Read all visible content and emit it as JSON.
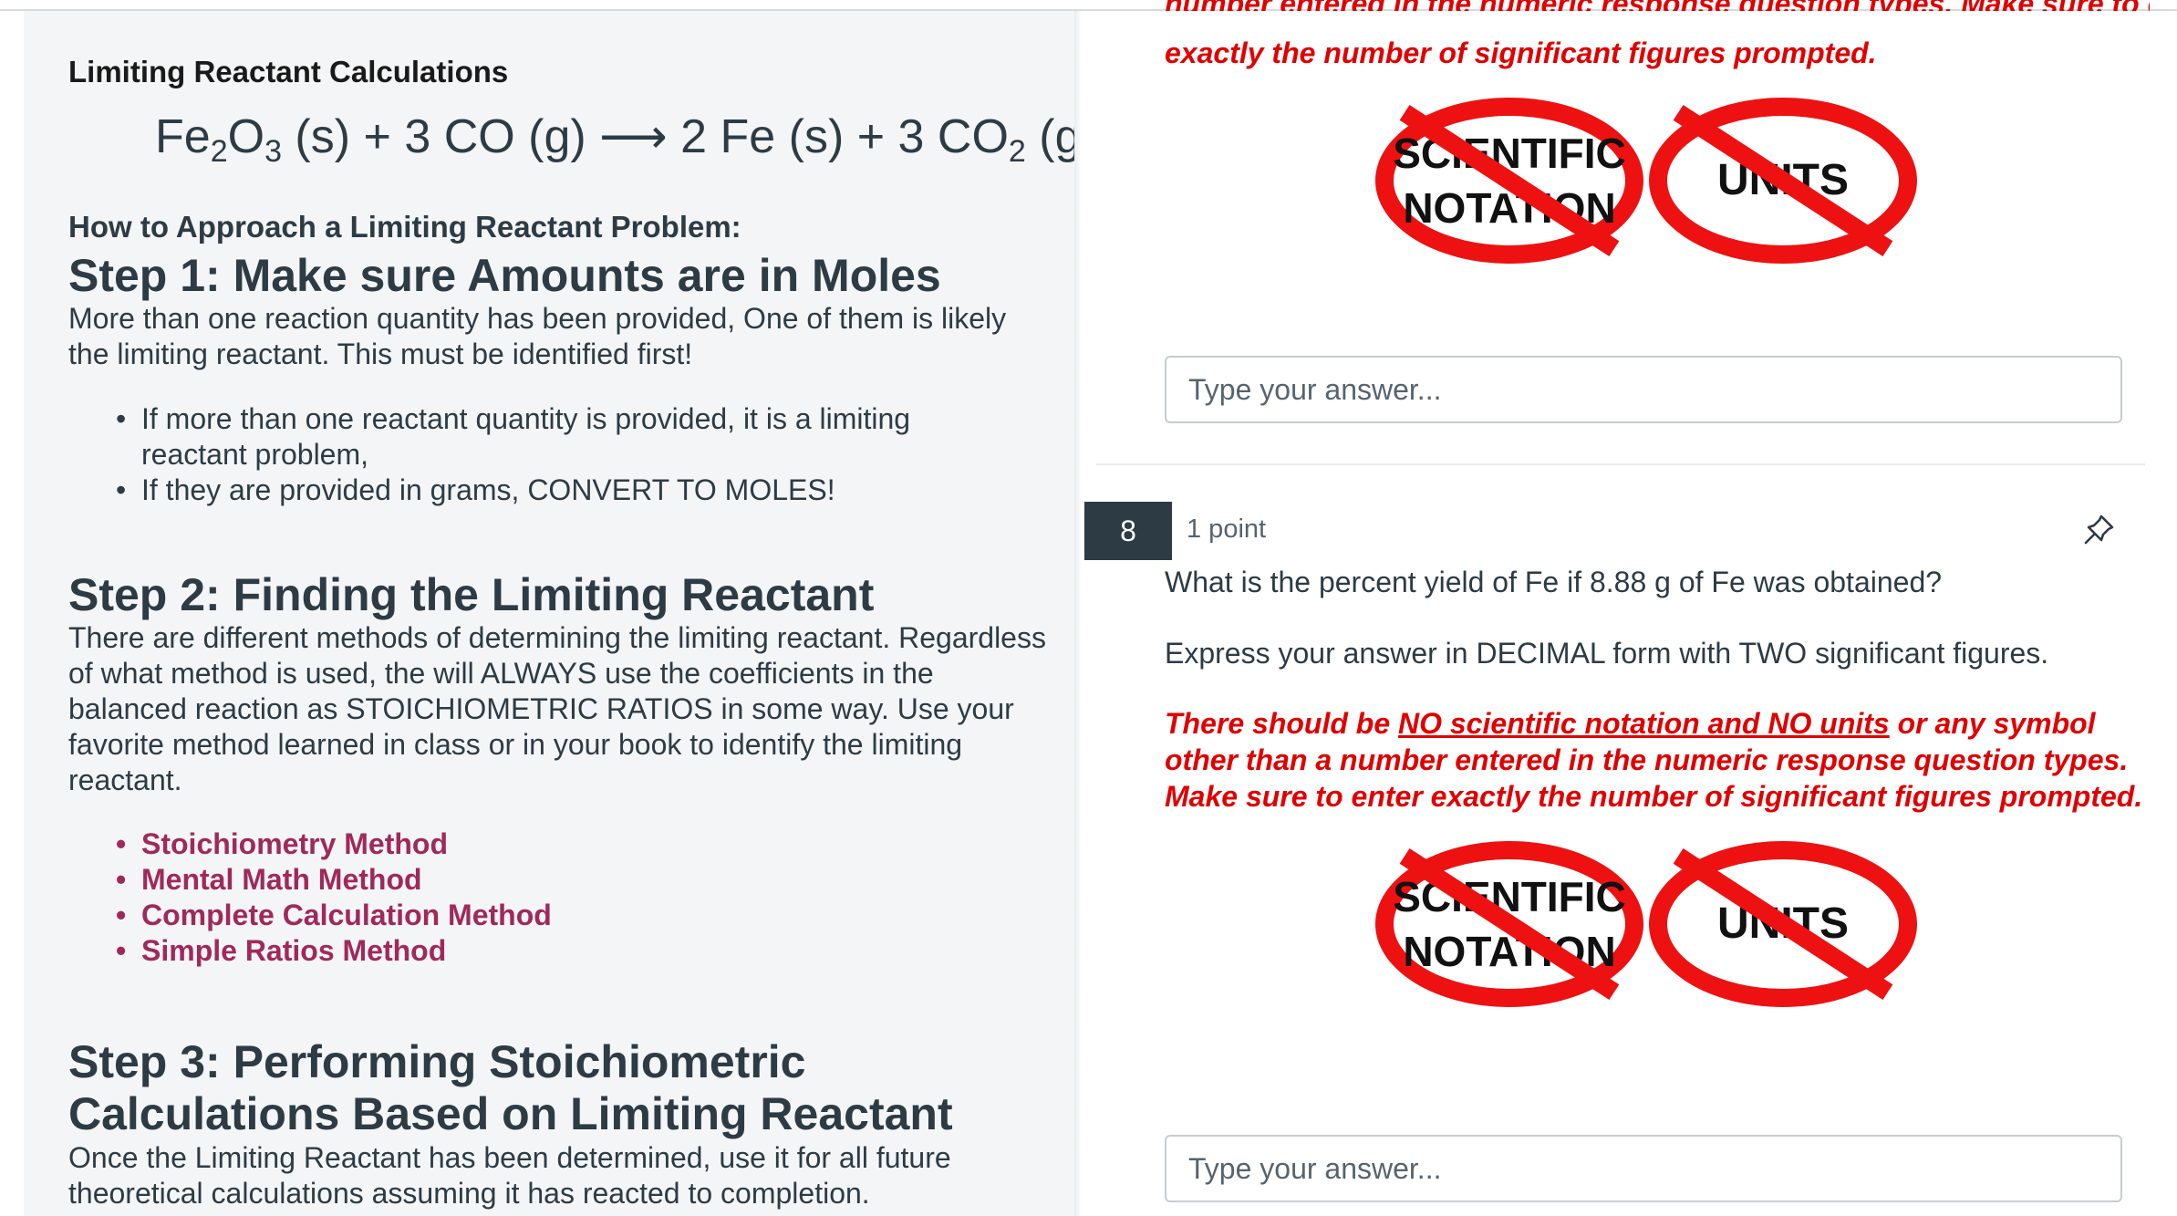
{
  "left": {
    "title": "Limiting Reactant Calculations",
    "equation": {
      "p1": "Fe",
      "s1": "2",
      "p2": "O",
      "s2": "3",
      "p3": " (s) + 3 CO (g) ",
      "arrow": "⟶",
      "p4": " 2 Fe (s) + 3 CO",
      "s3": "2",
      "p5": " (g)"
    },
    "approach_heading": "How to Approach a Limiting Reactant Problem:",
    "step1": {
      "heading": "Step 1: Make sure Amounts are in Moles",
      "body": "More than one reaction quantity has been provided, One of them is likely the limiting reactant. This must be identified first!",
      "bullets": [
        "If more than one reactant quantity is provided, it is a limiting reactant problem,",
        "If they are provided in grams, CONVERT TO MOLES!"
      ]
    },
    "step2": {
      "heading": "Step 2: Finding the Limiting Reactant",
      "body": "There are different methods of determining the limiting reactant. Regardless of what method is used, the will ALWAYS use the coefficients in the balanced reaction as STOICHIOMETRIC RATIOS in some way. Use your favorite method learned in class or in your book to identify the limiting reactant.",
      "links": [
        "Stoichiometry Method",
        "Mental Math Method",
        "Complete Calculation Method",
        "Simple Ratios Method"
      ]
    },
    "step3": {
      "heading": "Step 3: Performing Stoichiometric Calculations Based on Limiting Reactant",
      "body": "Once the Limiting Reactant has been determined, use it for all future theoretical calculations assuming it has reacted to completion."
    }
  },
  "right": {
    "prev_question": {
      "clipped_line": "number entered in the  numeric response question types. Make sure to enter",
      "last_line": "exactly the number of significant figures prompted.",
      "answer_placeholder": "Type your answer..."
    },
    "question8": {
      "number": "8",
      "points": "1 point",
      "text": "What is the percent yield of Fe if 8.88 g of Fe was obtained?",
      "instruction": "Express your answer in DECIMAL form with TWO significant figures.",
      "warning": {
        "pre": "There should be ",
        "underlined": "NO scientific notation and NO units",
        "post": " or any symbol other than a number entered in the  numeric response question types. Make sure to enter exactly the number of significant figures prompted."
      },
      "answer_placeholder": "Type your answer..."
    },
    "badges": {
      "sci_line1": "SCIENTIFIC",
      "sci_line2": "NOTATION",
      "units": "UNITS"
    }
  },
  "colors": {
    "text": "#2d3b45",
    "link": "#a0295b",
    "warning_red": "#e00000",
    "no_sign_red": "#ee1111",
    "question_badge": "#2d3b45"
  },
  "icons": [
    "pin-icon",
    "no-sign-icon"
  ]
}
